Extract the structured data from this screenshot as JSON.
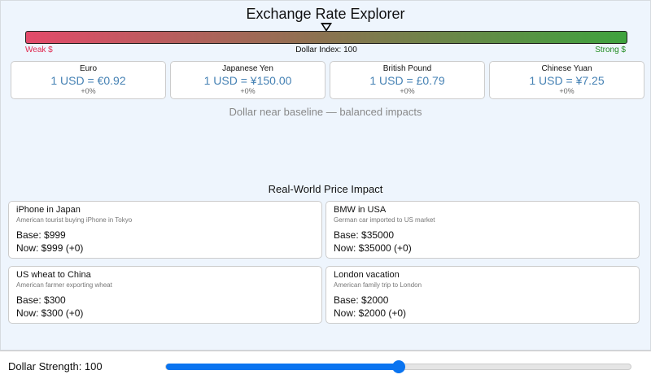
{
  "title": "Exchange Rate Explorer",
  "gauge": {
    "weak_label": "Weak $",
    "index_label": "Dollar Index: 100",
    "strong_label": "Strong $",
    "weak_color": "#e34a6a",
    "strong_color": "#3ea33e"
  },
  "currencies": [
    {
      "name": "Euro",
      "rate": "1 USD = €0.92",
      "change": "+0%"
    },
    {
      "name": "Japanese Yen",
      "rate": "1 USD = ¥150.00",
      "change": "+0%"
    },
    {
      "name": "British Pound",
      "rate": "1 USD = £0.79",
      "change": "+0%"
    },
    {
      "name": "Chinese Yuan",
      "rate": "1 USD = ¥7.25",
      "change": "+0%"
    }
  ],
  "status": "Dollar near baseline — balanced impacts",
  "impact_title": "Real-World Price Impact",
  "impacts": [
    {
      "title": "iPhone in Japan",
      "desc": "American tourist buying iPhone in Tokyo",
      "base": "Base: $999",
      "now": "Now: $999 (+0)"
    },
    {
      "title": "BMW in USA",
      "desc": "German car imported to US market",
      "base": "Base: $35000",
      "now": "Now: $35000 (+0)"
    },
    {
      "title": "US wheat to China",
      "desc": "American farmer exporting wheat",
      "base": "Base: $300",
      "now": "Now: $300 (+0)"
    },
    {
      "title": "London vacation",
      "desc": "American family trip to London",
      "base": "Base: $2000",
      "now": "Now: $2000 (+0)"
    }
  ],
  "control": {
    "label": "Dollar Strength: 100",
    "slider_fraction": 0.5,
    "accent": "#0a74f0"
  }
}
